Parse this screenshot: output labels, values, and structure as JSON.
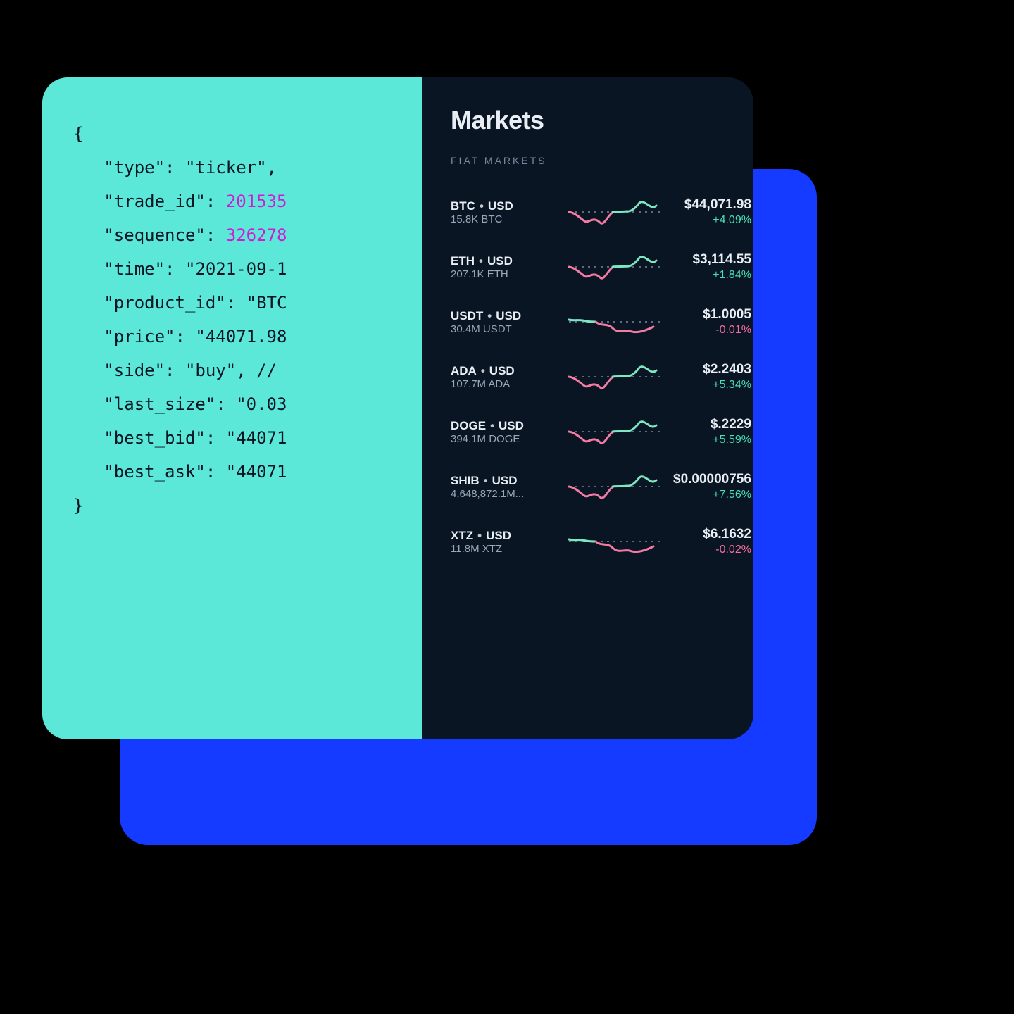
{
  "code_block": {
    "lines": [
      {
        "t": "plain",
        "s": "{"
      },
      {
        "t": "kv",
        "k": "type",
        "v": "\"ticker\","
      },
      {
        "t": "kn",
        "k": "trade_id",
        "v": "201535"
      },
      {
        "t": "kn",
        "k": "sequence",
        "v": "326278"
      },
      {
        "t": "kv",
        "k": "time",
        "v": "\"2021-09-1"
      },
      {
        "t": "kv",
        "k": "product_id",
        "v": "\"BTC"
      },
      {
        "t": "kv",
        "k": "price",
        "v": "\"44071.98"
      },
      {
        "t": "kv",
        "k": "side",
        "v": "\"buy\", // "
      },
      {
        "t": "kv",
        "k": "last_size",
        "v": "\"0.03"
      },
      {
        "t": "kv",
        "k": "best_bid",
        "v": "\"44071"
      },
      {
        "t": "kv",
        "k": "best_ask",
        "v": "\"44071"
      },
      {
        "t": "plain",
        "s": "}"
      }
    ]
  },
  "markets": {
    "title": "Markets",
    "section": "FIAT MARKETS",
    "rows": [
      {
        "base": "BTC",
        "quote": "USD",
        "vol": "15.8K BTC",
        "price": "$44,071.98",
        "chg": "+4.09%",
        "dir": "pos"
      },
      {
        "base": "ETH",
        "quote": "USD",
        "vol": "207.1K ETH",
        "price": "$3,114.55",
        "chg": "+1.84%",
        "dir": "pos"
      },
      {
        "base": "USDT",
        "quote": "USD",
        "vol": "30.4M USDT",
        "price": "$1.0005",
        "chg": "-0.01%",
        "dir": "neg"
      },
      {
        "base": "ADA",
        "quote": "USD",
        "vol": "107.7M ADA",
        "price": "$2.2403",
        "chg": "+5.34%",
        "dir": "pos"
      },
      {
        "base": "DOGE",
        "quote": "USD",
        "vol": "394.1M DOGE",
        "price": "$.2229",
        "chg": "+5.59%",
        "dir": "pos"
      },
      {
        "base": "SHIB",
        "quote": "USD",
        "vol": "4,648,872.1M...",
        "price": "$0.00000756",
        "chg": "+7.56%",
        "dir": "pos"
      },
      {
        "base": "XTZ",
        "quote": "USD",
        "vol": "11.8M XTZ",
        "price": "$6.1632",
        "chg": "-0.02%",
        "dir": "neg"
      }
    ]
  },
  "chart_data": [
    {
      "type": "line",
      "title": "BTC·USD sparkline",
      "series": [
        {
          "name": "above",
          "values": [
            22,
            23,
            22,
            23,
            18,
            10,
            22,
            14
          ]
        },
        {
          "name": "below",
          "values": [
            23,
            24,
            30,
            36,
            28,
            38,
            24
          ]
        }
      ],
      "baseline": 23
    },
    {
      "type": "line",
      "title": "ETH·USD sparkline",
      "series": [
        {
          "name": "above",
          "values": [
            22,
            23,
            22,
            23,
            18,
            10,
            22,
            14
          ]
        },
        {
          "name": "below",
          "values": [
            23,
            24,
            30,
            36,
            28,
            38,
            24
          ]
        }
      ],
      "baseline": 23
    },
    {
      "type": "line",
      "title": "USDT·USD sparkline",
      "series": [
        {
          "name": "above",
          "values": [
            20,
            22,
            19,
            23
          ]
        },
        {
          "name": "below",
          "values": [
            23,
            30,
            24,
            32,
            40,
            34,
            36,
            30
          ]
        }
      ],
      "baseline": 23
    },
    {
      "type": "line",
      "title": "ADA·USD sparkline",
      "series": [
        {
          "name": "above",
          "values": [
            22,
            23,
            22,
            23,
            18,
            10,
            22,
            14
          ]
        },
        {
          "name": "below",
          "values": [
            23,
            24,
            30,
            36,
            28,
            38,
            24
          ]
        }
      ],
      "baseline": 23
    },
    {
      "type": "line",
      "title": "DOGE·USD sparkline",
      "series": [
        {
          "name": "above",
          "values": [
            22,
            23,
            22,
            23,
            18,
            10,
            22,
            14
          ]
        },
        {
          "name": "below",
          "values": [
            23,
            24,
            30,
            36,
            28,
            38,
            24
          ]
        }
      ],
      "baseline": 23
    },
    {
      "type": "line",
      "title": "SHIB·USD sparkline",
      "series": [
        {
          "name": "above",
          "values": [
            22,
            23,
            22,
            23,
            18,
            10,
            22,
            14
          ]
        },
        {
          "name": "below",
          "values": [
            23,
            24,
            30,
            36,
            28,
            38,
            24
          ]
        }
      ],
      "baseline": 23
    },
    {
      "type": "line",
      "title": "XTZ·USD sparkline",
      "series": [
        {
          "name": "above",
          "values": [
            20,
            22,
            19,
            23
          ]
        },
        {
          "name": "below",
          "values": [
            23,
            30,
            24,
            32,
            40,
            34,
            36,
            30
          ]
        }
      ],
      "baseline": 23
    }
  ]
}
